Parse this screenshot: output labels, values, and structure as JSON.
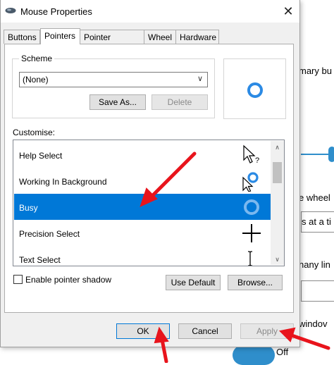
{
  "background": {
    "texts": [
      "mary bu",
      "e wheel",
      "s at a ti",
      "nany lin",
      "windov",
      "Off"
    ]
  },
  "dialog": {
    "title": "Mouse Properties",
    "close_label": "✕",
    "tabs": [
      {
        "label": "Buttons",
        "active": false
      },
      {
        "label": "Pointers",
        "active": true
      },
      {
        "label": "Pointer Options",
        "active": false
      },
      {
        "label": "Wheel",
        "active": false
      },
      {
        "label": "Hardware",
        "active": false
      }
    ],
    "scheme": {
      "label": "Scheme",
      "selected": "(None)",
      "save_as_label": "Save As...",
      "delete_label": "Delete"
    },
    "customise": {
      "label": "Customise:",
      "items": [
        {
          "label": "Help Select",
          "cursor": "help-select-cursor-icon",
          "selected": false
        },
        {
          "label": "Working In Background",
          "cursor": "working-in-background-cursor-icon",
          "selected": false
        },
        {
          "label": "Busy",
          "cursor": "busy-cursor-icon",
          "selected": true
        },
        {
          "label": "Precision Select",
          "cursor": "precision-select-cursor-icon",
          "selected": false
        },
        {
          "label": "Text Select",
          "cursor": "text-select-cursor-icon",
          "selected": false
        }
      ]
    },
    "enable_shadow_label": "Enable pointer shadow",
    "enable_shadow_checked": false,
    "use_default_label": "Use Default",
    "browse_label": "Browse...",
    "ok_label": "OK",
    "cancel_label": "Cancel",
    "apply_label": "Apply"
  },
  "colors": {
    "accent": "#0078d7",
    "ring": "#2b8ae4",
    "arrow": "#e8141c"
  }
}
